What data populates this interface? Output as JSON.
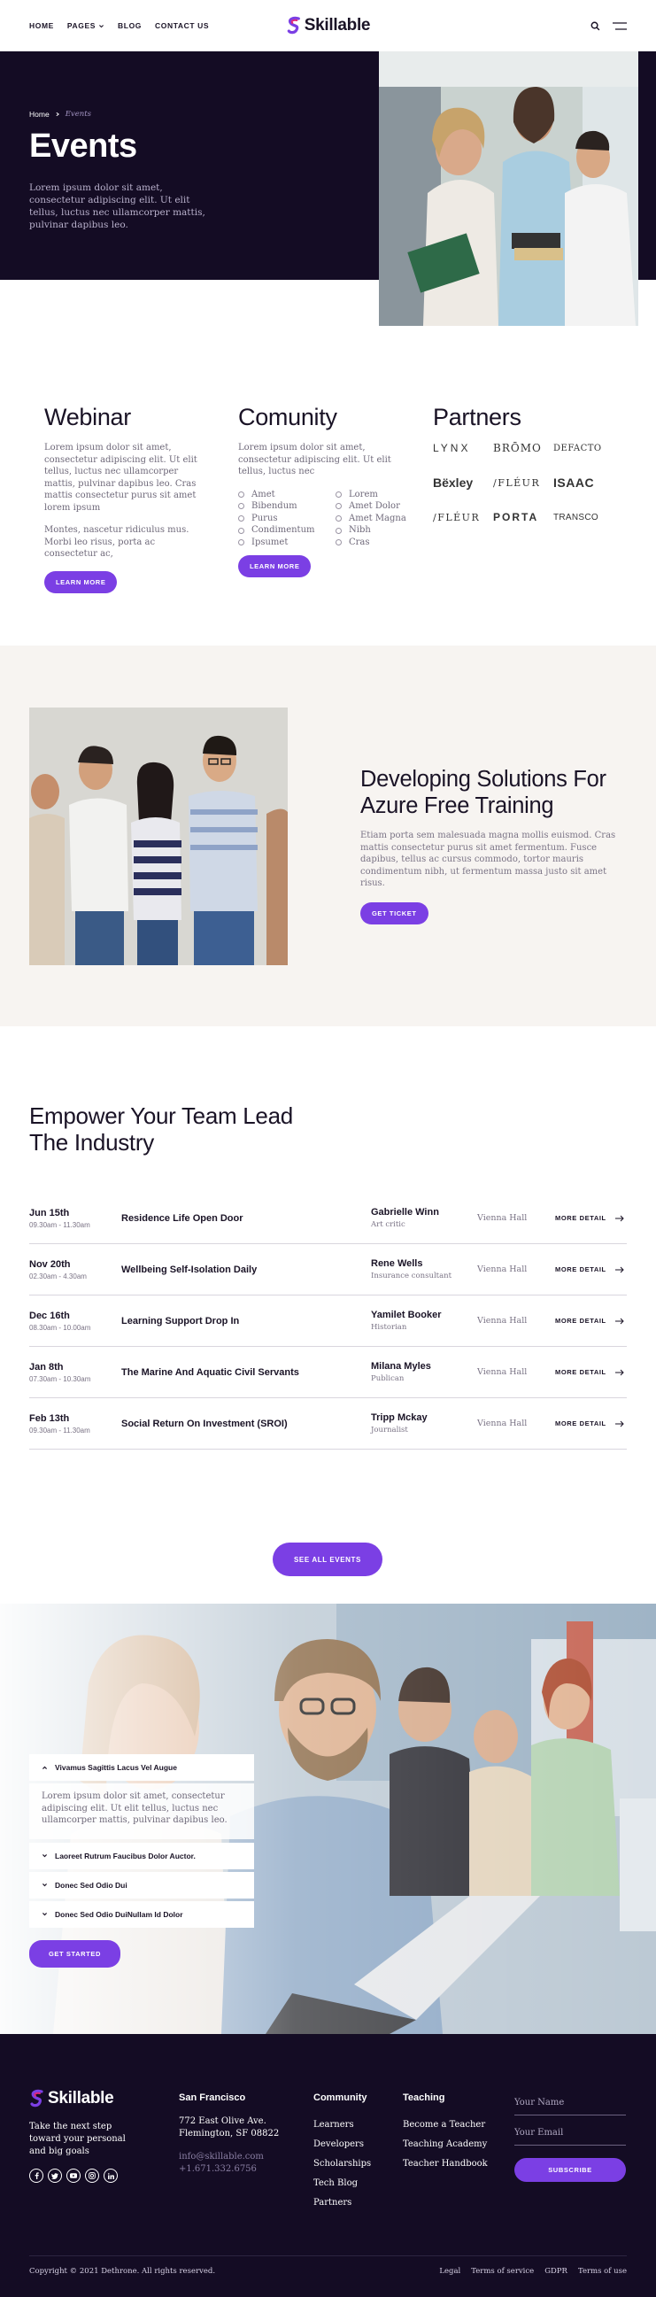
{
  "header": {
    "nav": [
      "HOME",
      "PAGES",
      "BLOG",
      "CONTACT US"
    ],
    "brand": "Skillable"
  },
  "hero": {
    "breadcrumb_home": "Home",
    "breadcrumb_current": "Events",
    "title": "Events",
    "text": "Lorem ipsum dolor sit amet, consectetur adipiscing elit. Ut elit tellus, luctus nec ullamcorper mattis, pulvinar dapibus leo."
  },
  "webinar": {
    "title": "Webinar",
    "p1": "Lorem ipsum dolor sit amet, consectetur adipiscing elit. Ut elit tellus, luctus nec ullamcorper mattis, pulvinar dapibus leo. Cras mattis consectetur purus sit amet lorem ipsum",
    "p2": "Montes, nascetur ridiculus mus. Morbi leo risus, porta ac consectetur ac,",
    "button": "LEARN MORE"
  },
  "community": {
    "title": "Comunity",
    "p1": "Lorem ipsum dolor sit amet, consectetur adipiscing elit. Ut elit tellus, luctus nec",
    "list_a": [
      "Amet",
      "Bibendum",
      "Purus",
      "Condimentum",
      "Ipsumet"
    ],
    "list_b": [
      "Lorem",
      "Amet Dolor",
      "Amet Magna",
      "Nibh",
      "Cras"
    ],
    "button": "LEARN MORE"
  },
  "partners": {
    "title": "Partners",
    "logos": [
      "LYNX",
      "BRŌMO",
      "DEFACTO",
      "Bëxley",
      "/FLÉUR",
      "ISAAC",
      "/FLÉUR",
      "PORTA",
      "TRANSCO"
    ]
  },
  "azure": {
    "title": "Developing Solutions For Azure Free Training",
    "text": "Etiam porta sem malesuada magna mollis euismod. Cras mattis consectetur purus sit amet fermentum. Fusce dapibus, tellus ac cursus commodo, tortor mauris condimentum nibh, ut fermentum massa justo sit amet risus.",
    "button": "GET TICKET"
  },
  "events": {
    "title": "Empower Your Team Lead The Industry",
    "more_label": "MORE DETAIL",
    "items": [
      {
        "date": "Jun 15th",
        "time": "09.30am - 11.30am",
        "title": "Residence Life Open Door",
        "person": "Gabrielle Winn",
        "role": "Art critic",
        "hall": "Vienna Hall"
      },
      {
        "date": "Nov 20th",
        "time": "02.30am - 4.30am",
        "title": "Wellbeing Self-Isolation Daily",
        "person": "Rene Wells",
        "role": "Insurance consultant",
        "hall": "Vienna Hall"
      },
      {
        "date": "Dec 16th",
        "time": "08.30am - 10.00am",
        "title": "Learning Support Drop In",
        "person": "Yamilet Booker",
        "role": "Historian",
        "hall": "Vienna Hall"
      },
      {
        "date": "Jan 8th",
        "time": "07.30am - 10.30am",
        "title": "The Marine And Aquatic Civil Servants",
        "person": "Milana Myles",
        "role": "Publican",
        "hall": "Vienna Hall"
      },
      {
        "date": "Feb 13th",
        "time": "09.30am - 11.30am",
        "title": "Social Return On Investment (SROI)",
        "person": "Tripp Mckay",
        "role": "Journalist",
        "hall": "Vienna Hall"
      }
    ],
    "see_all": "SEE ALL EVENTS"
  },
  "faq": {
    "open_title": "Vivamus Sagittis Lacus Vel Augue",
    "open_text": "Lorem ipsum dolor sit amet, consectetur adipiscing elit. Ut elit tellus, luctus nec ullamcorper mattis, pulvinar dapibus leo.",
    "closed": [
      "Laoreet Rutrum Faucibus Dolor Auctor.",
      "Donec Sed Odio Dui",
      "Donec Sed Odio DuiNullam Id Dolor"
    ],
    "button": "GET STARTED"
  },
  "footer": {
    "brand": "Skillable",
    "tagline": "Take the next step toward your personal and big goals",
    "city": "San Francisco",
    "address1": "772 East Olive Ave.",
    "address2": "Flemington, SF 08822",
    "email": "info@skillable.com",
    "phone": "+1.671.332.6756",
    "community_title": "Community",
    "community_links": [
      "Learners",
      "Developers",
      "Scholarships",
      "Tech Blog",
      "Partners"
    ],
    "teaching_title": "Teaching",
    "teaching_links": [
      "Become a Teacher",
      "Teaching Academy",
      "Teacher Handbook"
    ],
    "name_placeholder": "Your Name",
    "email_placeholder": "Your Email",
    "subscribe": "SUBSCRIBE",
    "copyright": "Copyright © 2021 Dethrone. All rights reserved.",
    "legal": [
      "Legal",
      "Terms of service",
      "GDPR",
      "Terms of use"
    ]
  },
  "colors": {
    "accent": "#7b3fe4",
    "dark": "#140c24",
    "cream": "#f7f4f1"
  }
}
